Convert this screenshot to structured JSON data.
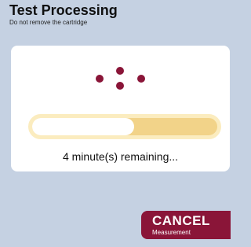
{
  "header": {
    "title": "Test Processing",
    "subtitle": "Do not remove the cartridge"
  },
  "status": {
    "icon": "loading-spinner-icon",
    "progress_fraction": 0.55,
    "remaining_text": "4 minute(s) remaining..."
  },
  "actions": {
    "cancel_label": "CANCEL",
    "cancel_sublabel": "Measurement"
  },
  "colors": {
    "background": "#c5d1e2",
    "card": "#ffffff",
    "accent": "#8a1538",
    "progress_track": "#f2d389",
    "progress_border": "#fbecbf",
    "progress_fill": "#ffffff"
  }
}
